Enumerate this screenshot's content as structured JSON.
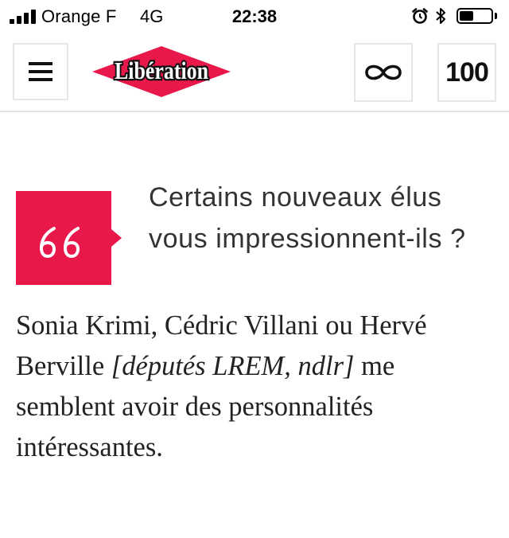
{
  "status_bar": {
    "carrier": "Orange F",
    "network": "4G",
    "time": "22:38",
    "signal_bars": 4,
    "battery_level": 0.45,
    "icons": [
      "signal-icon",
      "alarm-icon",
      "bluetooth-icon",
      "battery-icon"
    ]
  },
  "header": {
    "logo_text": "Libération",
    "menu_icon": "hamburger-icon",
    "infinite_icon": "infinity-icon",
    "count_label": "100",
    "colors": {
      "brand_red": "#e8184b",
      "border": "#e6e6e6"
    }
  },
  "article": {
    "quote_icon": "quote-icon",
    "question": "Certains nouveaux élus vous impressionnent-ils ?",
    "answer": {
      "part1": "Sonia Krimi, Cédric Villani ou Hervé Berville ",
      "editorial_note": "[députés LREM, ndlr]",
      "part2": " me semblent avoir des personnalités intéressantes."
    }
  }
}
